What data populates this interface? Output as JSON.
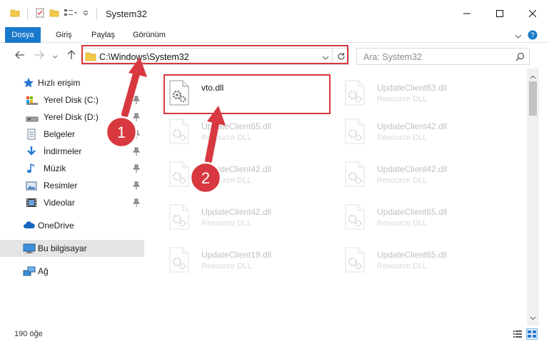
{
  "window": {
    "title": "System32"
  },
  "ribbon": {
    "tabs": [
      "Dosya",
      "Giriş",
      "Paylaş",
      "Görünüm"
    ]
  },
  "address": {
    "path": "C:\\Windows\\System32",
    "search_placeholder": "Ara: System32"
  },
  "sidebar": {
    "quick_access": "Hızlı erişim",
    "items": [
      {
        "label": "Yerel Disk (C:)",
        "icon": "drive-icon"
      },
      {
        "label": "Yerel Disk (D:)",
        "icon": "drive-icon"
      },
      {
        "label": "Belgeler",
        "icon": "documents-icon"
      },
      {
        "label": "İndirmeler",
        "icon": "download-icon"
      },
      {
        "label": "Müzik",
        "icon": "music-icon"
      },
      {
        "label": "Resimler",
        "icon": "pictures-icon"
      },
      {
        "label": "Videolar",
        "icon": "videos-icon"
      }
    ],
    "onedrive": "OneDrive",
    "this_pc": "Bu bilgisayar",
    "network": "Ağ"
  },
  "files": [
    {
      "name": "vto.dll",
      "type": ""
    },
    {
      "name": "UpdateClient63.dll",
      "type": "Resource DLL"
    },
    {
      "name": "UpdateClient65.dll",
      "type": "Resource DLL"
    },
    {
      "name": "UpdateClient42.dll",
      "type": "Resource DLL"
    },
    {
      "name": "UpdateClient42.dll",
      "type": "Resource DLL"
    },
    {
      "name": "UpdateClient42.dll",
      "type": "Resource DLL"
    },
    {
      "name": "UpdateClient42.dll",
      "type": "Resource DLL"
    },
    {
      "name": "UpdateClient65.dll",
      "type": "Resource DLL"
    },
    {
      "name": "UpdateClient19.dll",
      "type": "Resource DLL"
    },
    {
      "name": "UpdateClient65.dll",
      "type": "Resource DLL"
    }
  ],
  "status": {
    "item_count": "190 öğe"
  },
  "annotations": {
    "step1": "1",
    "step2": "2"
  },
  "colors": {
    "accent": "#1979ca",
    "highlight": "#d8383f"
  }
}
